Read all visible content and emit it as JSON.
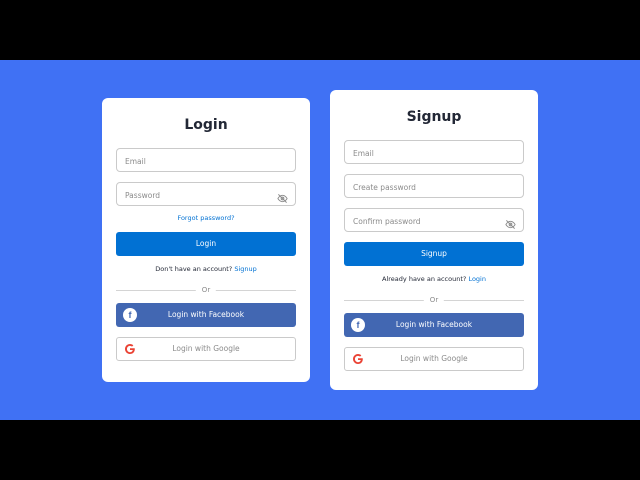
{
  "login": {
    "title": "Login",
    "email_placeholder": "Email",
    "password_placeholder": "Password",
    "forgot_label": "Forgot password?",
    "submit_label": "Login",
    "switch_text": "Don't have an account?",
    "switch_link": "Signup",
    "divider_label": "Or",
    "facebook_label": "Login with Facebook",
    "google_label": "Login with Google"
  },
  "signup": {
    "title": "Signup",
    "email_placeholder": "Email",
    "create_password_placeholder": "Create password",
    "confirm_password_placeholder": "Confirm password",
    "submit_label": "Signup",
    "switch_text": "Already have an account?",
    "switch_link": "Login",
    "divider_label": "Or",
    "facebook_label": "Login with Facebook",
    "google_label": "Login with Google"
  },
  "icons": {
    "eye": "eye-slash-icon",
    "facebook": "facebook-icon",
    "google": "google-icon"
  },
  "colors": {
    "background": "#4071f4",
    "primary": "#0171d3",
    "facebook": "#4267b2"
  }
}
